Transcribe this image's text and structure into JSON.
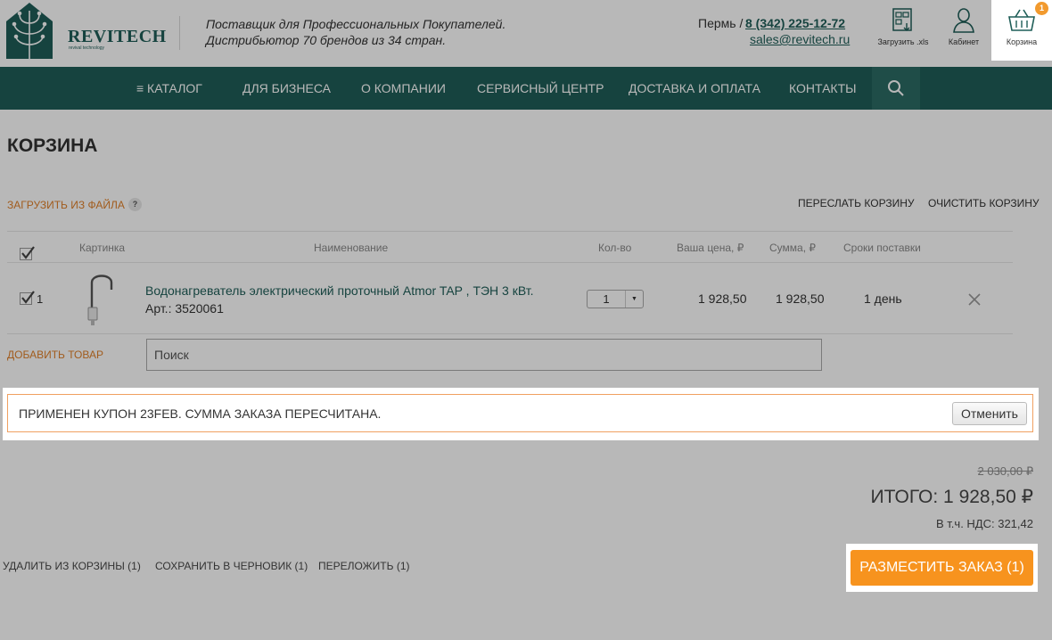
{
  "header": {
    "brand": "REVITECH",
    "brand_sub": "revival technology",
    "tagline_line1": "Поставщик для Профессиональных Покупателей.",
    "tagline_line2": "Дистрибьютор 70 брендов из 34 стран.",
    "city": "Пермь /",
    "phone": "8 (342) 225-12-72",
    "email": "sales@revitech.ru",
    "upload_xls_label": "Загрузить .xls",
    "cabinet_label": "Кабинет",
    "cart_label": "Корзина",
    "cart_count": "1"
  },
  "nav": {
    "items": [
      {
        "label": "≡  Каталог"
      },
      {
        "label": "Для бизнеса"
      },
      {
        "label": "О компании"
      },
      {
        "label": "Сервисный центр"
      },
      {
        "label": "Доставка и оплата"
      },
      {
        "label": "Контакты"
      }
    ]
  },
  "page": {
    "title": "КОРЗИНА",
    "upload_from_file": "Загрузить из файла",
    "help": "?",
    "forward_cart": "Переслать корзину",
    "clear_cart": "Очистить корзину"
  },
  "table": {
    "headers": {
      "picture": "Картинка",
      "name": "Наименование",
      "qty": "Кол-во",
      "your_price": "Ваша цена, ₽",
      "sum": "Сумма, ₽",
      "delivery": "Сроки поставки"
    },
    "rows": [
      {
        "num": "1",
        "name": "Водонагреватель электрический проточный Atmor TAP , ТЭН 3 кВт.",
        "sku": "Арт.: 3520061",
        "qty": "1",
        "price": "1 928,50",
        "sum": "1 928,50",
        "delivery": "1 день"
      }
    ],
    "add_item": "Добавить товар",
    "search_placeholder": "Поиск"
  },
  "coupon": {
    "message": "Применен купон 23FEB. Сумма заказа пересчитана.",
    "cancel": "Отменить"
  },
  "totals": {
    "old_total": "2 030,00 ₽",
    "total": "ИТОГО: 1 928,50 ₽",
    "vat": "В т.ч. НДС: 321,42"
  },
  "bottom": {
    "delete": "Удалить из корзины (1)",
    "save_draft": "Сохранить в черновик (1)",
    "move": "Переложить (1)",
    "place_order": "Разместить заказ (1)"
  },
  "colors": {
    "brand": "#1f5e58",
    "accent": "#f7931e",
    "link_orange": "#e0802a"
  }
}
